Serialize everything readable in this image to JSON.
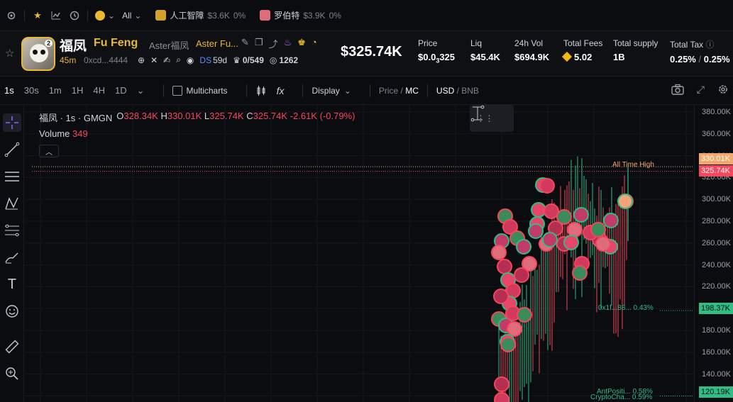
{
  "topbar": {
    "chain_filter": "All",
    "tickers": [
      {
        "name": "人工智障",
        "mc": "$3.6K",
        "change": "0%",
        "color": "#d4a22a"
      },
      {
        "name": "罗伯特",
        "mc": "$3.9K",
        "change": "0%",
        "color": "#e06b7a"
      }
    ]
  },
  "token": {
    "avatar_badge": "2",
    "name": "福凤",
    "symbol_name": "Fu Feng",
    "desc": "Aster福凤",
    "desc2": "Aster Fu...",
    "age": "45m",
    "address": "0xcd...4444",
    "ds_label": "DS",
    "ds_age": "59d",
    "holders_ratio": "0/549",
    "views": "1262",
    "price_big": "$325.74K",
    "stats": {
      "price_label": "Price",
      "price_value_a": "$0.0",
      "price_value_sub": "3",
      "price_value_b": "325",
      "liq_label": "Liq",
      "liq_value": "$45.4K",
      "vol_label": "24h Vol",
      "vol_value": "$694.9K",
      "fees_label": "Total Fees",
      "fees_value": "5.02",
      "supply_label": "Total supply",
      "supply_value": "1B",
      "tax_label": "Total Tax",
      "tax_buy": "0.25%",
      "tax_sep": "/",
      "tax_sell": "0.25%"
    }
  },
  "toolbar": {
    "timeframes": [
      "1s",
      "30s",
      "1m",
      "1H",
      "4H",
      "1D"
    ],
    "multicharts": "Multicharts",
    "fx": "fx",
    "display": "Display",
    "price_label": "Price",
    "mc_label": "MC",
    "usd_label": "USD",
    "bnb_label": "BNB"
  },
  "chart": {
    "legend_title": "福凤 · 1s · GMGN",
    "o_label": "O",
    "o_value": "328.34K",
    "h_label": "H",
    "h_value": "330.01K",
    "l_label": "L",
    "l_value": "325.74K",
    "c_label": "C",
    "c_value": "325.74K",
    "change": "-2.61K (-0.79%)",
    "volume_label": "Volume",
    "volume_value": "349",
    "ath_label": "All Time High",
    "label_1f": "0x1f...88... 0.43%",
    "label_ant": "AntPositi... 0.58%",
    "label_crypto": "CryptoCha... 0.59%",
    "axis_ticks": [
      "380.00K",
      "360.00K",
      "340.00K",
      "320.00K",
      "300.00K",
      "280.00K",
      "260.00K",
      "240.00K",
      "220.00K",
      "200.00K",
      "180.00K",
      "160.00K",
      "140.00K"
    ],
    "tag_ath": "330.01K",
    "tag_last": "325.74K",
    "tag_198": "198.37K",
    "tag_120": "120.19K"
  },
  "chart_data": {
    "type": "candlestick",
    "y_unit": "market cap (USD)",
    "ylim": [
      120000,
      390000
    ],
    "ohlc_last": {
      "open": 328340,
      "high": 330010,
      "low": 325740,
      "close": 325740
    },
    "all_time_high": 330010,
    "last_price": 325740,
    "reference_lines": [
      {
        "label": "0x1f...88... 0.43%",
        "value": 198370
      },
      {
        "label": "AntPositi... 0.58%",
        "value": 120190
      },
      {
        "label": "CryptoCha... 0.59%",
        "value": 120190
      }
    ]
  }
}
